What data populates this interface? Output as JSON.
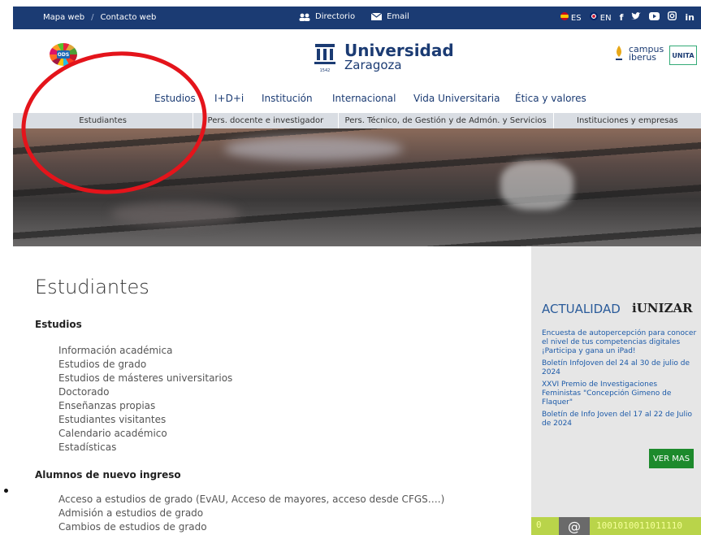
{
  "topbar": {
    "mapa": "Mapa web",
    "sep": "/",
    "contacto": "Contacto web",
    "directorio": "Directorio",
    "email": "Email",
    "lang_es": "ES",
    "lang_en": "EN",
    "social": [
      "f",
      "𝕪",
      "▶",
      "◘",
      "in"
    ]
  },
  "header": {
    "ods_text": "ODS",
    "univ_title": "Universidad",
    "univ_sub": "Zaragoza",
    "campus_line1": "campus",
    "campus_line2": "iberus",
    "unita": "UNITA"
  },
  "mainnav": [
    "Estudios",
    "I+D+i",
    "Institución",
    "Internacional",
    "Vida Universitaria",
    "Ética y valores"
  ],
  "subnav": [
    "Estudiantes",
    "Pers. docente e investigador",
    "Pers. Técnico, de Gestión y de Admón. y Servicios",
    "Instituciones y empresas"
  ],
  "content": {
    "title": "Estudiantes",
    "sec1": "Estudios",
    "sec1_items": [
      "Información académica",
      "Estudios de grado",
      "Estudios de másteres universitarios",
      "Doctorado",
      "Enseñanzas propias",
      "Estudiantes visitantes",
      "Calendario académico",
      "Estadísticas"
    ],
    "sec2": "Alumnos de nuevo ingreso",
    "sec2_items": [
      "Acceso a estudios de grado (EvAU, Acceso de mayores, acceso desde CFGS….)",
      "Admisión a estudios de grado",
      "Cambios de estudios de grado"
    ]
  },
  "sidebar": {
    "actualidad": "ACTUALIDAD",
    "brand": "iUNIZAR",
    "news": [
      "Encuesta de autopercepción para conocer el nivel de tus competencias digitales ¡Participa y gana un iPad!",
      "Boletín InfoJoven del 24 al 30 de julio de 2024",
      "XXVI Premio de Investigaciones Feministas \"Concepción Gimeno de Flaquer\"",
      "Boletín de Info Joven del 17 al 22 de Julio de 2024"
    ],
    "more": "VER MAS",
    "banner_left": "0",
    "banner_at": "@",
    "banner_bits": "1001010011011110"
  },
  "colors": {
    "navy": "#1b3b73",
    "annotation_red": "#e4141b",
    "button_green": "#1d8a2c"
  }
}
